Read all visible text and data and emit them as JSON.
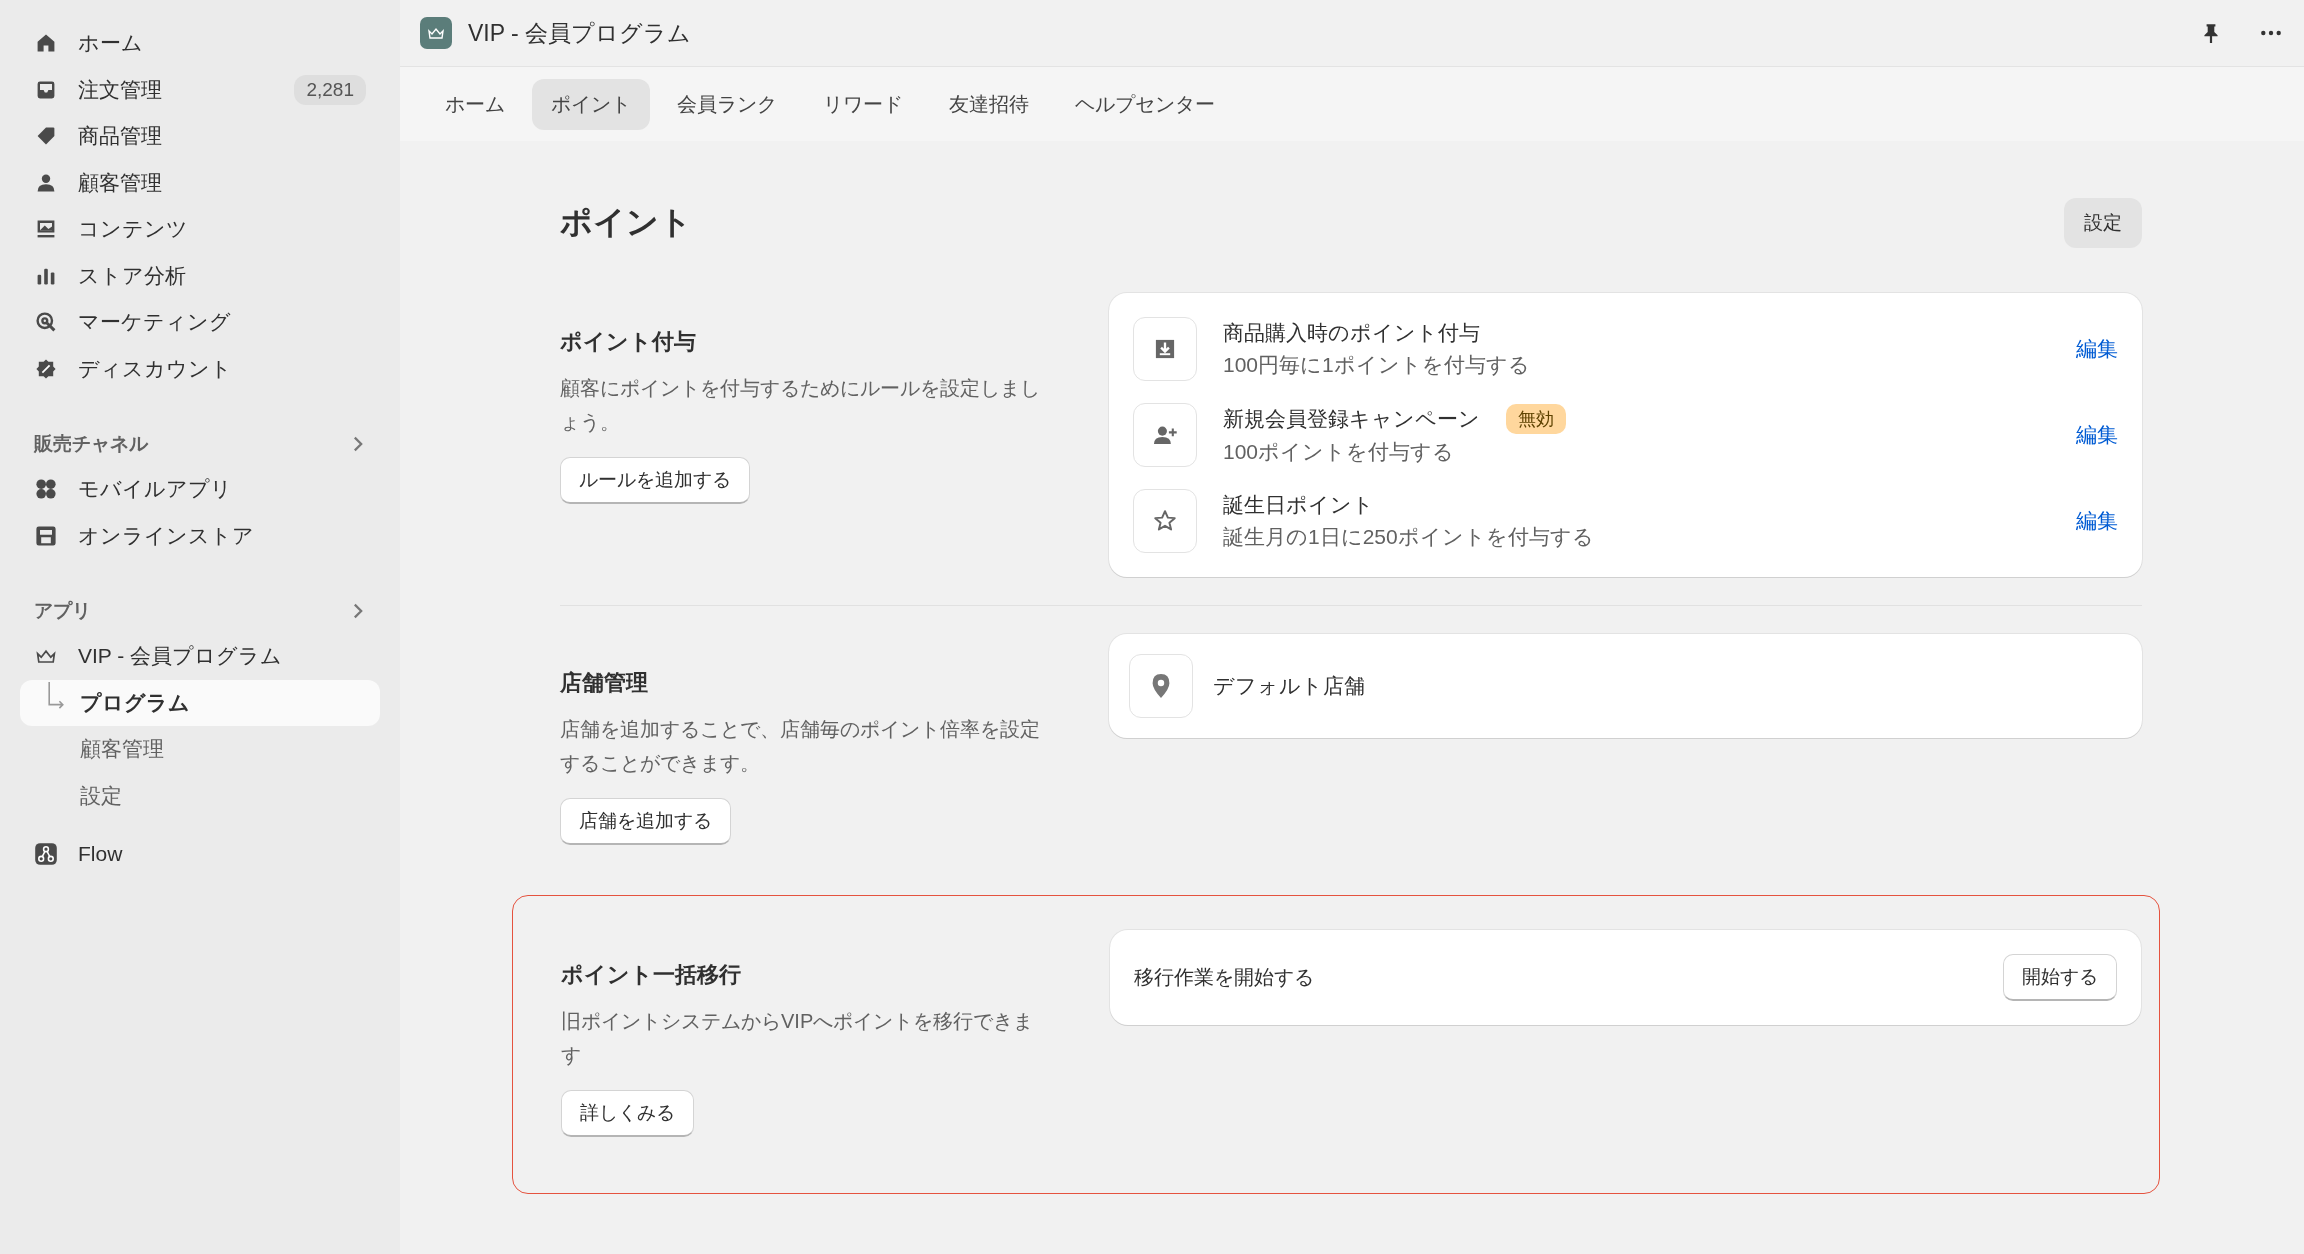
{
  "sidebar": {
    "main_items": [
      {
        "label": "ホーム",
        "selected": false
      },
      {
        "label": "注文管理",
        "badge": "2,281",
        "selected": false
      },
      {
        "label": "商品管理",
        "selected": false
      },
      {
        "label": "顧客管理",
        "selected": false
      },
      {
        "label": "コンテンツ",
        "selected": false
      },
      {
        "label": "ストア分析",
        "selected": false
      },
      {
        "label": "マーケティング",
        "selected": false
      },
      {
        "label": "ディスカウント",
        "selected": false
      }
    ],
    "sales_channels": {
      "title": "販売チャネル",
      "items": [
        {
          "label": "モバイルアプリ",
          "selected": false
        },
        {
          "label": "オンラインストア",
          "selected": false
        }
      ]
    },
    "apps": {
      "title": "アプリ",
      "app": {
        "label": "VIP - 会員プログラム",
        "children": [
          {
            "label": "プログラム",
            "selected": true
          },
          {
            "label": "顧客管理",
            "selected": false
          },
          {
            "label": "設定",
            "selected": false
          }
        ]
      }
    },
    "flow": {
      "label": "Flow",
      "selected": false
    }
  },
  "header": {
    "title": "VIP - 会員プログラム"
  },
  "tabs": [
    {
      "label": "ホーム",
      "selected": false
    },
    {
      "label": "ポイント",
      "selected": true
    },
    {
      "label": "会員ランク",
      "selected": false
    },
    {
      "label": "リワード",
      "selected": false
    },
    {
      "label": "友達招待",
      "selected": false
    },
    {
      "label": "ヘルプセンター",
      "selected": false
    }
  ],
  "page": {
    "title": "ポイント",
    "settings_button": "設定"
  },
  "sections": [
    {
      "kind": "rules",
      "title": "ポイント付与",
      "description": "顧客にポイントを付与するためにルールを設定しましょう。",
      "button": "ルールを追加する",
      "highlighted": false,
      "rules": [
        {
          "title": "商品購入時のポイント付与",
          "subtitle": "100円毎に1ポイントを付与する",
          "action": "編集"
        },
        {
          "title": "新規会員登録キャンペーン",
          "badge": "無効",
          "subtitle": "100ポイントを付与する",
          "action": "編集"
        },
        {
          "title": "誕生日ポイント",
          "subtitle": "誕生月の1日に250ポイントを付与する",
          "action": "編集"
        }
      ]
    },
    {
      "kind": "stores",
      "title": "店舗管理",
      "description": "店舗を追加することで、店舗毎のポイント倍率を設定することができます。",
      "button": "店舗を追加する",
      "highlighted": false,
      "stores": [
        {
          "name": "デフォルト店舗"
        }
      ]
    },
    {
      "kind": "migration",
      "title": "ポイント一括移行",
      "description": "旧ポイントシステムからVIPへポイントを移行できます",
      "button": "詳しくみる",
      "highlighted": true,
      "task": {
        "label": "移行作業を開始する",
        "button": "開始する"
      }
    }
  ]
}
